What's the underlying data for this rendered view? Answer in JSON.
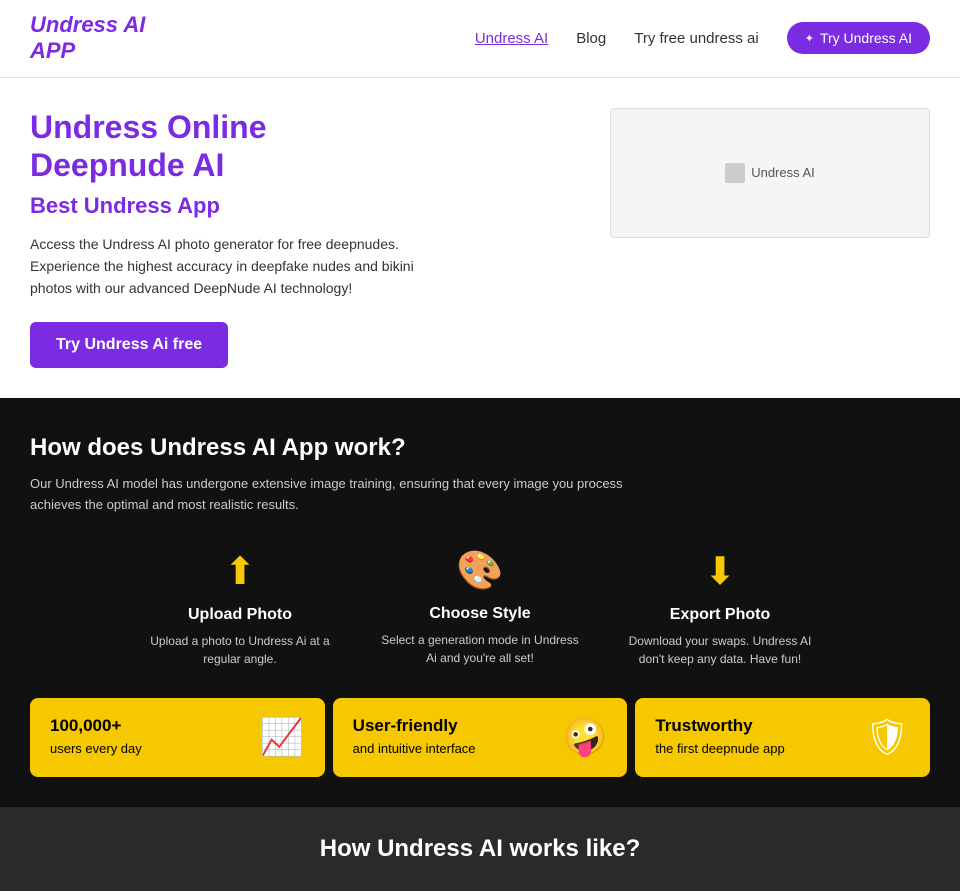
{
  "header": {
    "logo_line1": "Undress AI",
    "logo_line2": "APP",
    "nav": [
      {
        "label": "Undress AI",
        "active": true
      },
      {
        "label": "Blog",
        "active": false
      },
      {
        "label": "Try free undress ai",
        "active": false
      }
    ],
    "cta_label": "Try Undress AI"
  },
  "hero": {
    "title": "Undress Online\nDeepnude AI",
    "subtitle": "Best Undress App",
    "description": "Access the Undress AI photo generator for free deepnudes. Experience the highest accuracy in deepfake nudes and bikini photos with our advanced DeepNude AI technology!",
    "button_label": "Try Undress Ai free",
    "image_alt": "Undress AI"
  },
  "how_section": {
    "title": "How does Undress AI App work?",
    "description": "Our Undress AI model has undergone extensive image training, ensuring that every image you process achieves the optimal and most realistic results.",
    "steps": [
      {
        "icon": "⬆",
        "title": "Upload Photo",
        "description": "Upload a photo to Undress Ai at a regular angle."
      },
      {
        "icon": "🎨",
        "title": "Choose Style",
        "description": "Select a generation mode in Undress Ai and you're all set!"
      },
      {
        "icon": "⬇",
        "title": "Export Photo",
        "description": "Download your swaps. Undress AI don't keep any data. Have fun!"
      }
    ],
    "features": [
      {
        "title": "100,000+",
        "description": "users every day",
        "icon": "📈"
      },
      {
        "title": "User-friendly",
        "description": "and intuitive interface",
        "icon": "🤪"
      },
      {
        "title": "Trustworthy",
        "description": "the first deepnude app",
        "icon": "🛡"
      }
    ]
  },
  "bottom": {
    "title": "How Undress AI works like?"
  }
}
